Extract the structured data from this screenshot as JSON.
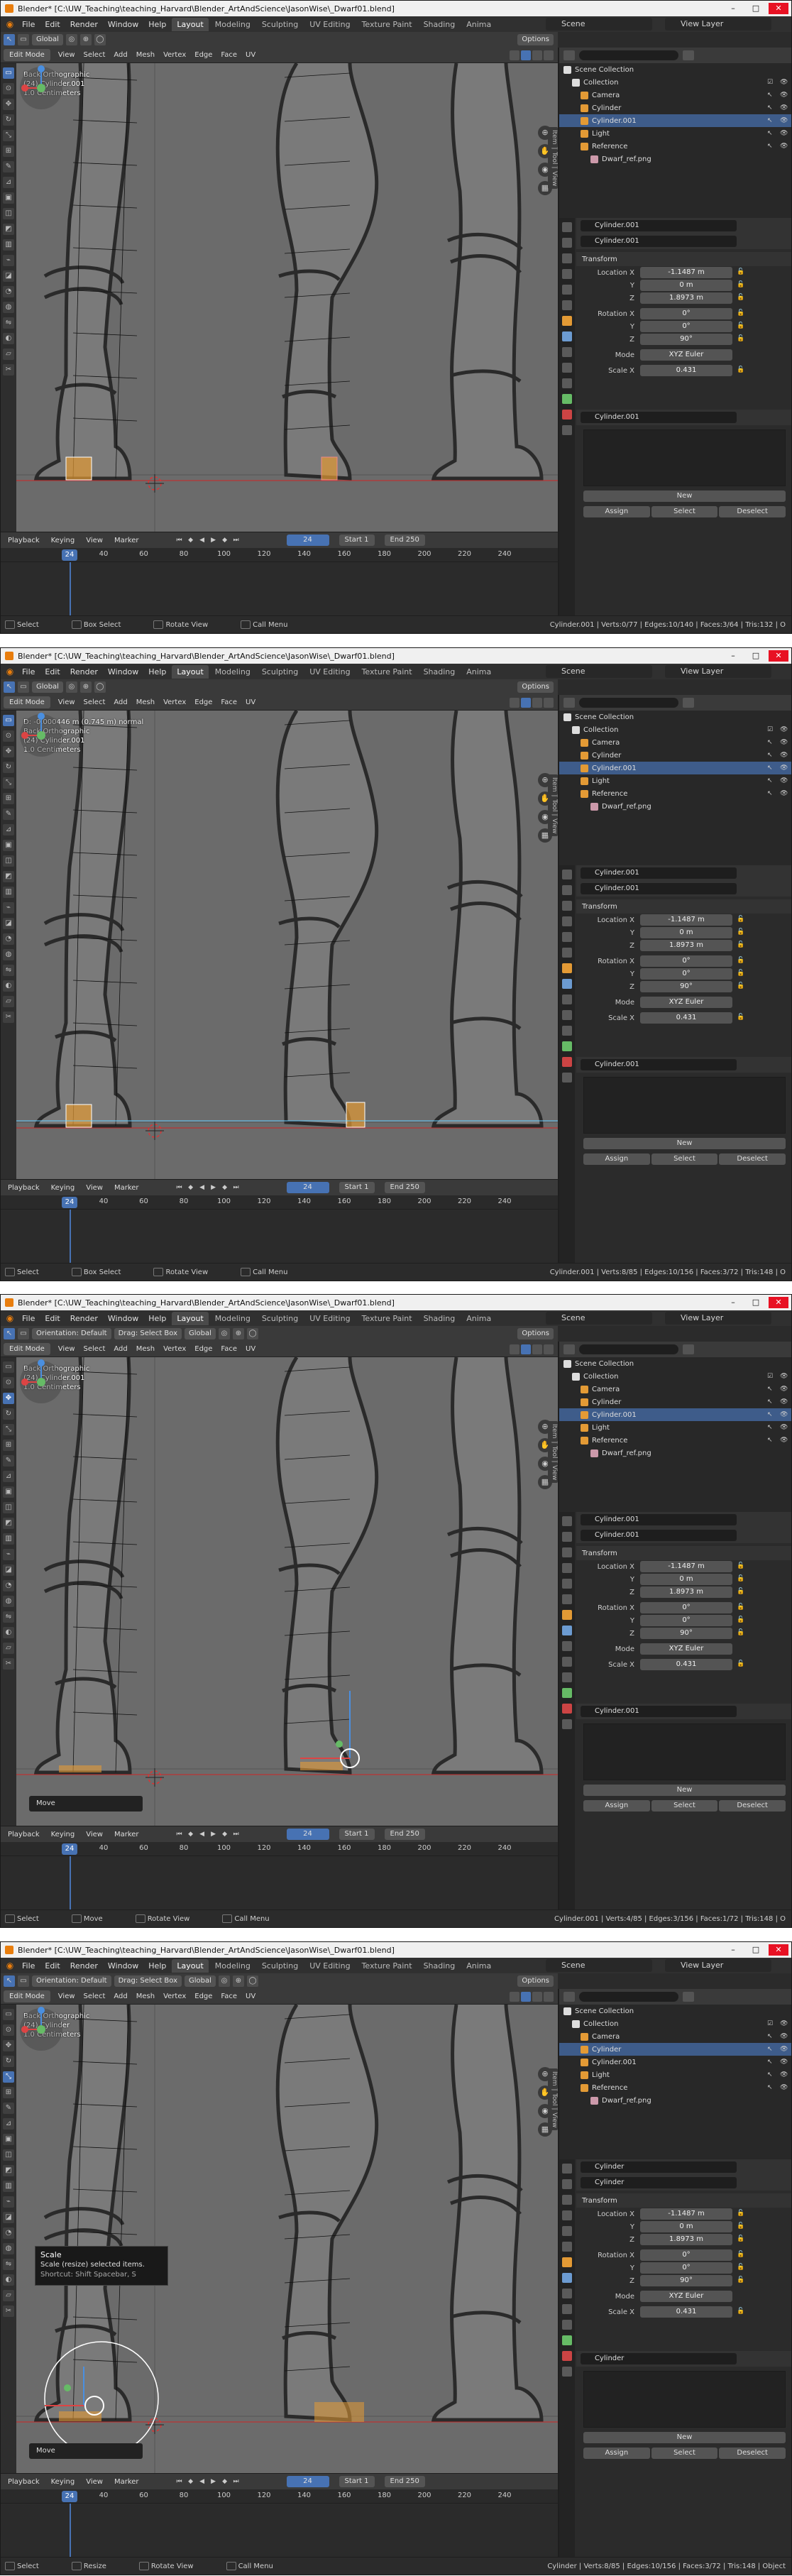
{
  "common": {
    "title": "Blender* [C:\\UW_Teaching\\teaching_Harvard\\Blender_ArtAndScience\\JasonWise\\_Dwarf01.blend]",
    "menu": [
      "File",
      "Edit",
      "Render",
      "Window",
      "Help"
    ],
    "workspaces": [
      "Layout",
      "Modeling",
      "Sculpting",
      "UV Editing",
      "Texture Paint",
      "Shading",
      "Anima"
    ],
    "scene": "Scene",
    "view_layer": "View Layer",
    "edit_mode": "Edit Mode",
    "header_menus": [
      "View",
      "Select",
      "Add",
      "Mesh",
      "Vertex",
      "Edge",
      "Face",
      "UV"
    ],
    "orientation_label": "Orientation:",
    "orientation_value": "Default",
    "drag_label": "Drag:",
    "select_box": "Select Box",
    "transform_orientation": "Global",
    "options": "Options",
    "view_overlay_1": "Back Orthographic",
    "view_overlay_3": "1.0 Centimeters",
    "timeline_menus": [
      "Playback",
      "Keying",
      "View",
      "Marker"
    ],
    "current_frame": "24",
    "start_label": "Start",
    "start_value": "1",
    "end_label": "End",
    "end_value": "250",
    "ruler_ticks": [
      "40",
      "60",
      "80",
      "100",
      "120",
      "140",
      "160",
      "180",
      "200",
      "220",
      "240"
    ],
    "outliner": {
      "scene_collection": "Scene Collection",
      "collection": "Collection",
      "camera": "Camera",
      "cylinder": "Cylinder",
      "cylinder001": "Cylinder.001",
      "light": "Light",
      "reference": "Reference",
      "dwarf_ref": "Dwarf_ref.png"
    },
    "props": {
      "transform": "Transform",
      "location_x_label": "Location X",
      "y_label": "Y",
      "z_label": "Z",
      "rotation_x_label": "Rotation X",
      "mode_label": "Mode",
      "mode_value": "XYZ Euler",
      "scale_x_label": "Scale X",
      "loc_x": "-1.1487 m",
      "loc_y": "0 m",
      "loc_z": "1.8973 m",
      "rot_x": "0°",
      "rot_y": "0°",
      "rot_z": "90°",
      "scale_x": "0.431",
      "new": "New",
      "assign": "Assign",
      "select": "Select",
      "deselect": "Deselect"
    },
    "side_tabs": [
      "Item",
      "Tool",
      "View"
    ],
    "status": {
      "select": "Select",
      "box_select": "Box Select",
      "rotate_view": "Rotate View",
      "call_menu": "Call Menu"
    }
  },
  "frames": [
    {
      "object_name": "Cylinder.001",
      "view_overlay_2": "(24) Cylinder.001",
      "status_mid": "Box Select",
      "stats": "Cylinder.001 | Verts:0/77 | Edges:10/140 | Faces:3/64 | Tris:132 | O",
      "hud": "",
      "selected_outliner": "cylinder001"
    },
    {
      "object_name": "Cylinder.001",
      "view_overlay_2": "(24) Cylinder.001",
      "hud": "D: -0.000446 m (0.745 m) normal",
      "status_mid": "Box Select",
      "stats": "Cylinder.001 | Verts:8/85 | Edges:10/156 | Faces:3/72 | Tris:148 | O",
      "selected_outliner": "cylinder001"
    },
    {
      "object_name": "Cylinder.001",
      "view_overlay_2": "(24) Cylinder.001",
      "hud": "",
      "status_mid": "Move",
      "toast": "Move",
      "stats": "Cylinder.001 | Verts:4/85 | Edges:3/156 | Faces:1/72 | Tris:148 | O",
      "selected_outliner": "cylinder001"
    },
    {
      "object_name": "Cylinder",
      "view_overlay_2": "(24) Cylinder",
      "hud": "",
      "status_mid": "Resize",
      "toast": "Move",
      "tooltip_title": "Scale",
      "tooltip_desc": "Scale (resize) selected items.",
      "tooltip_shortcut": "Shortcut: Shift Spacebar, S",
      "stats": "Cylinder | Verts:8/85 | Edges:10/156 | Faces:3/72 | Tris:148 | Object",
      "selected_outliner": "cylinder"
    }
  ],
  "colors": {
    "selection_orange": "#e39a35",
    "active_blue": "#4772b3",
    "viewport_bg": "#6b6b6b"
  }
}
